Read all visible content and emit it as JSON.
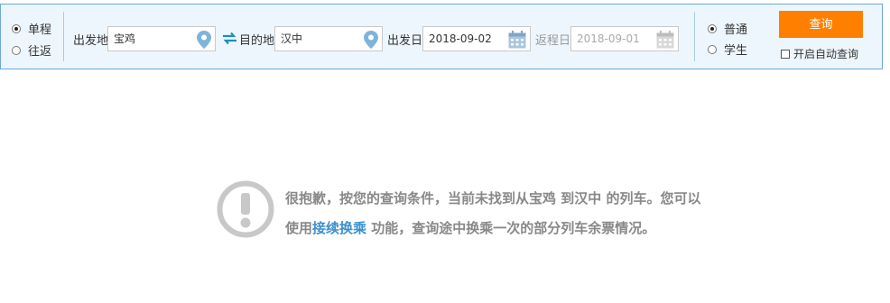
{
  "trip_type": {
    "options": [
      {
        "label": "单程",
        "checked": true
      },
      {
        "label": "往返",
        "checked": false
      }
    ]
  },
  "from": {
    "label": "出发地",
    "value": "宝鸡",
    "icon": "location-pin-icon"
  },
  "swap": {
    "icon": "swap-arrows-icon"
  },
  "to": {
    "label": "目的地",
    "value": "汉中",
    "icon": "location-pin-icon"
  },
  "depart_date": {
    "label": "出发日",
    "value": "2018-09-02",
    "icon": "calendar-icon"
  },
  "return_date": {
    "label": "返程日",
    "value": "2018-09-01",
    "icon": "calendar-icon",
    "disabled": true
  },
  "ticket_type": {
    "options": [
      {
        "label": "普通",
        "checked": true
      },
      {
        "label": "学生",
        "checked": false
      }
    ]
  },
  "search_button": {
    "label": "查询"
  },
  "auto_query": {
    "label": "开启自动查询",
    "checked": false
  },
  "notice": {
    "icon": "exclamation-circle-icon",
    "text_before": "很抱歉，按您的查询条件，当前未找到从宝鸡 到汉中 的列车。您可以使用",
    "link": "接续换乘",
    "text_after": " 功能，查询途中换乘一次的部分列车余票情况。"
  },
  "colors": {
    "border": "#6aa9d6",
    "bar_background": "#eef6fd",
    "button": "#ff8000",
    "link": "#3b8fcf",
    "icon_blue": "#7db4da",
    "swap_teal": "#1a8fb8",
    "notice_gray": "#888888"
  }
}
